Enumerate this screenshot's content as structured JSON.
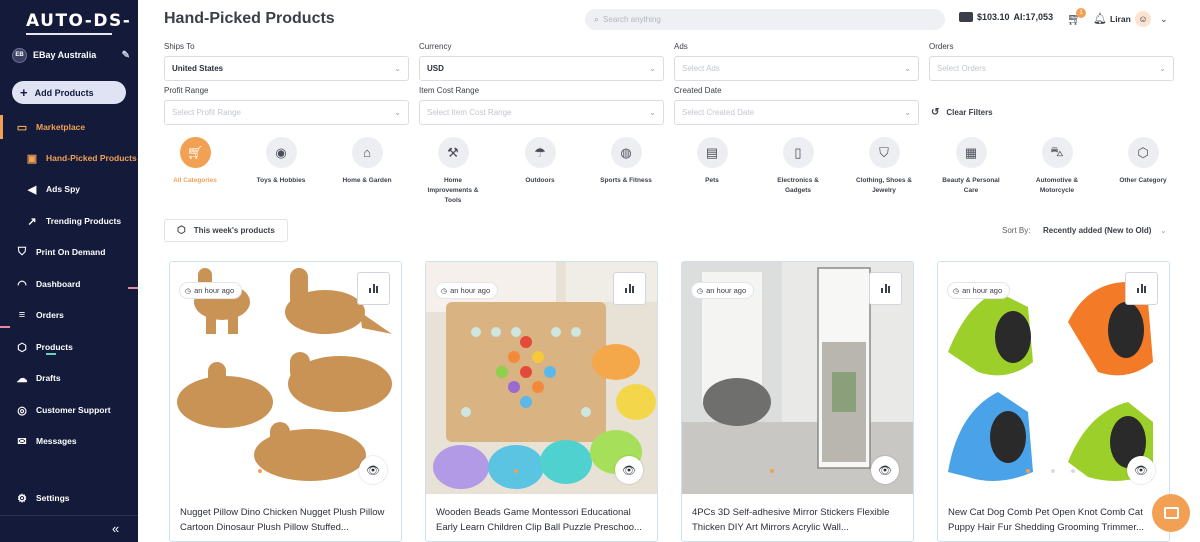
{
  "app": {
    "logo": "AUTO-DS-"
  },
  "sidebar": {
    "store_badge": "EB",
    "store_name": "EBay Australia",
    "add_products": "Add Products",
    "items": [
      {
        "label": "Marketplace",
        "icon": "store-icon"
      },
      {
        "label": "Hand-Picked Products",
        "icon": "hand-picked-icon"
      },
      {
        "label": "Ads Spy",
        "icon": "megaphone-icon"
      },
      {
        "label": "Trending Products",
        "icon": "trending-icon"
      },
      {
        "label": "Print On Demand",
        "icon": "shirt-icon"
      },
      {
        "label": "Dashboard",
        "icon": "gauge-icon"
      },
      {
        "label": "Orders",
        "icon": "orders-icon"
      },
      {
        "label": "Products",
        "icon": "box-icon"
      },
      {
        "label": "Drafts",
        "icon": "cloud-upload-icon"
      },
      {
        "label": "Customer Support",
        "icon": "headset-icon"
      },
      {
        "label": "Messages",
        "icon": "mail-icon"
      },
      {
        "label": "Settings",
        "icon": "gear-icon"
      }
    ],
    "collapse": "«"
  },
  "header": {
    "title": "Hand-Picked Products",
    "search_placeholder": "Search anything",
    "balance": "$103.10",
    "ai_credits": "AI:17,053",
    "cart_count": "1",
    "user_name": "Liran"
  },
  "filters": {
    "ships_to": {
      "label": "Ships To",
      "value": "United States"
    },
    "currency": {
      "label": "Currency",
      "value": "USD"
    },
    "ads": {
      "label": "Ads",
      "placeholder": "Select Ads"
    },
    "orders": {
      "label": "Orders",
      "placeholder": "Select Orders"
    },
    "profit_range": {
      "label": "Profit Range",
      "placeholder": "Select Profit Range"
    },
    "item_cost_range": {
      "label": "Item Cost Range",
      "placeholder": "Select Item Cost Range"
    },
    "created_date": {
      "label": "Created Date",
      "placeholder": "Select Created Date"
    },
    "clear": "Clear Filters"
  },
  "categories": [
    {
      "label": "All Categories",
      "icon": "cart-icon",
      "active": true
    },
    {
      "label": "Toys & Hobbies",
      "icon": "gamepad-icon"
    },
    {
      "label": "Home & Garden",
      "icon": "house-icon"
    },
    {
      "label": "Home Improvements & Tools",
      "icon": "tools-icon"
    },
    {
      "label": "Outdoors",
      "icon": "umbrella-icon"
    },
    {
      "label": "Sports & Fitness",
      "icon": "ball-icon"
    },
    {
      "label": "Pets",
      "icon": "pet-food-icon"
    },
    {
      "label": "Electronics & Gadgets",
      "icon": "phone-icon"
    },
    {
      "label": "Clothing, Shoes & Jewelry",
      "icon": "shirt-icon"
    },
    {
      "label": "Beauty & Personal Care",
      "icon": "makeup-icon"
    },
    {
      "label": "Automotive & Motorcycle",
      "icon": "car-icon"
    },
    {
      "label": "Other Category",
      "icon": "cube-icon"
    }
  ],
  "toolbar": {
    "week_button": "This week's products",
    "sort_label": "Sort By:",
    "sort_value": "Recently added (New to Old)"
  },
  "products": [
    {
      "time": "an hour ago",
      "title": "Nugget Pillow Dino Chicken Nugget Plush Pillow Cartoon Dinosaur Plush Pillow Stuffed..."
    },
    {
      "time": "an hour ago",
      "title": "Wooden Beads Game Montessori Educational Early Learn Children Clip Ball Puzzle Preschoo..."
    },
    {
      "time": "an hour ago",
      "title": "4PCs 3D Self-adhesive Mirror Stickers Flexible Thicken DIY Art Mirrors Acrylic Wall..."
    },
    {
      "time": "an hour ago",
      "title": "New Cat Dog Comb Pet Open Knot Comb Cat Puppy Hair Fur Shedding Grooming Trimmer..."
    }
  ],
  "colors": {
    "sidebar": "#141a3a",
    "accent": "#f2a154"
  }
}
